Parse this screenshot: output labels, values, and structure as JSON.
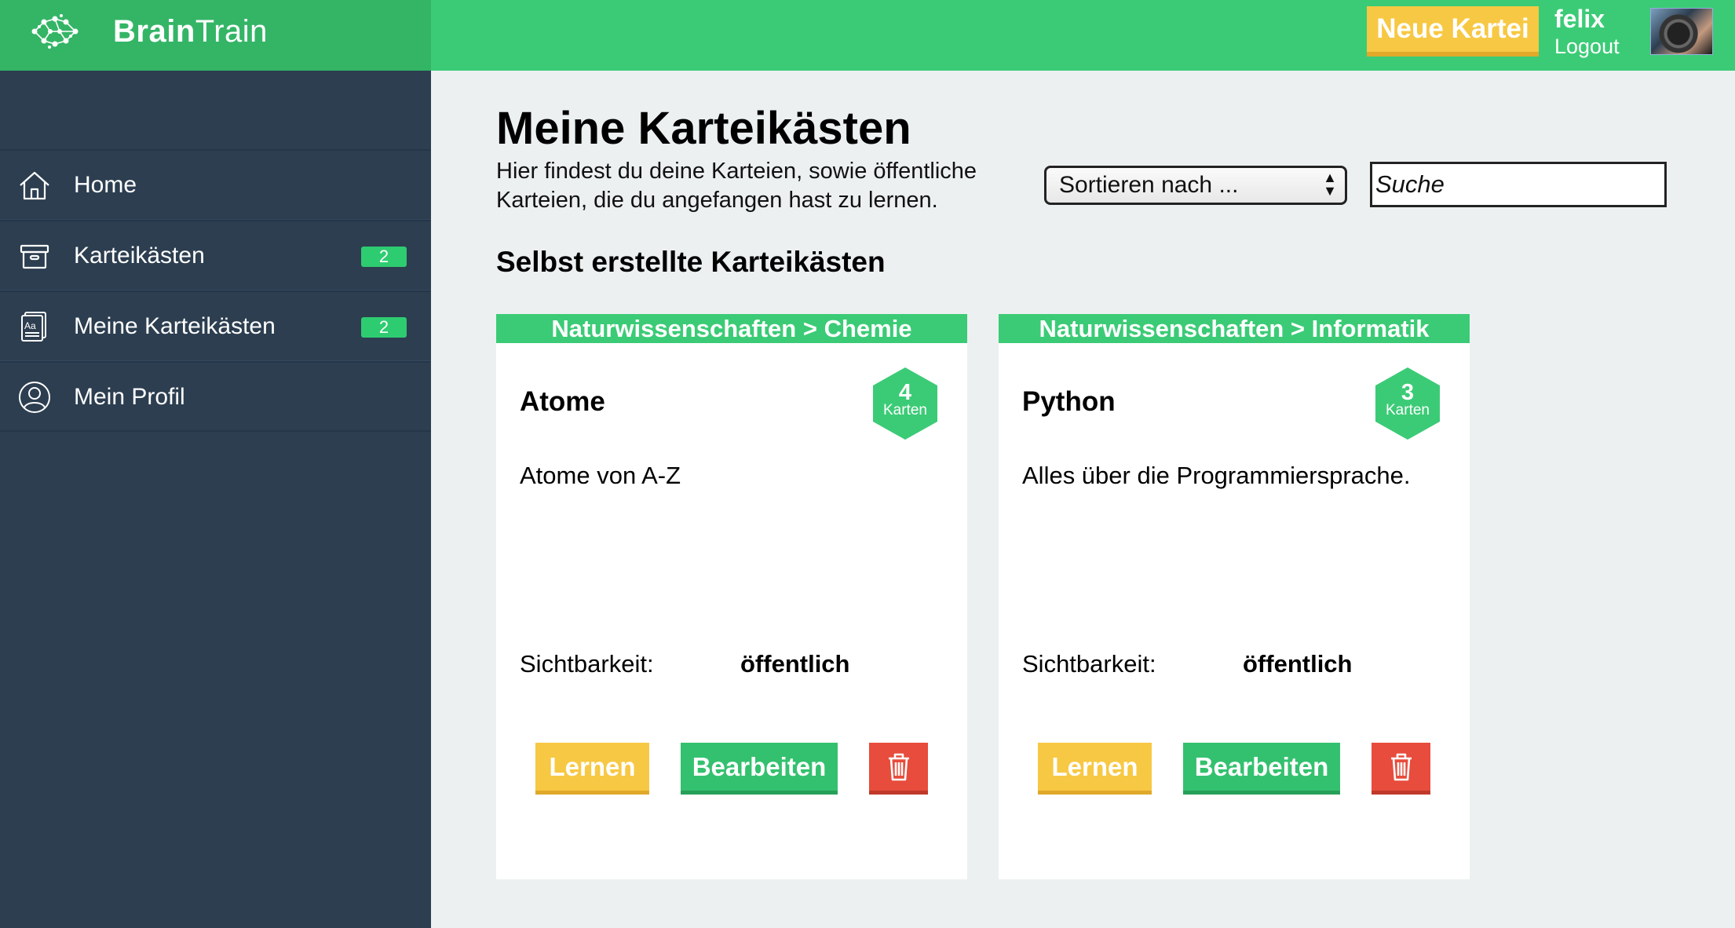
{
  "brand": {
    "name_bold": "Brain",
    "name_regular": "Train"
  },
  "header": {
    "new_button": "Neue Kartei",
    "user_name": "felix",
    "logout": "Logout"
  },
  "sidebar": {
    "items": [
      {
        "label": "Home",
        "icon": "home-icon"
      },
      {
        "label": "Karteikästen",
        "icon": "archive-box-icon",
        "badge": "2"
      },
      {
        "label": "Meine Karteikästen",
        "icon": "flashcards-icon",
        "badge": "2"
      },
      {
        "label": "Mein Profil",
        "icon": "user-profile-icon"
      }
    ]
  },
  "main": {
    "title": "Meine Karteikästen",
    "subtitle": "Hier findest du deine Karteien, sowie öffentliche Karteien, die du angefangen hast zu lernen.",
    "sort": {
      "selected": "Sortieren nach ..."
    },
    "search": {
      "placeholder": "Suche"
    },
    "section_title": "Selbst erstellte Karteikästen",
    "cards": [
      {
        "category": "Naturwissenschaften > Chemie",
        "title": "Atome",
        "count": "4",
        "count_label": "Karten",
        "description": "Atome von A-Z",
        "visibility_label": "Sichtbarkeit:",
        "visibility_value": "öffentlich",
        "learn": "Lernen",
        "edit": "Bearbeiten"
      },
      {
        "category": "Naturwissenschaften > Informatik",
        "title": "Python",
        "count": "3",
        "count_label": "Karten",
        "description": "Alles über die Programmiersprache.",
        "visibility_label": "Sichtbarkeit:",
        "visibility_value": "öffentlich",
        "learn": "Lernen",
        "edit": "Bearbeiten"
      }
    ]
  },
  "colors": {
    "primary_green": "#3bcb76",
    "dark_green": "#34b566",
    "sidebar_bg": "#2c3e50",
    "yellow": "#f7c843",
    "red": "#e74c3c",
    "page_bg": "#ecf0f1"
  }
}
